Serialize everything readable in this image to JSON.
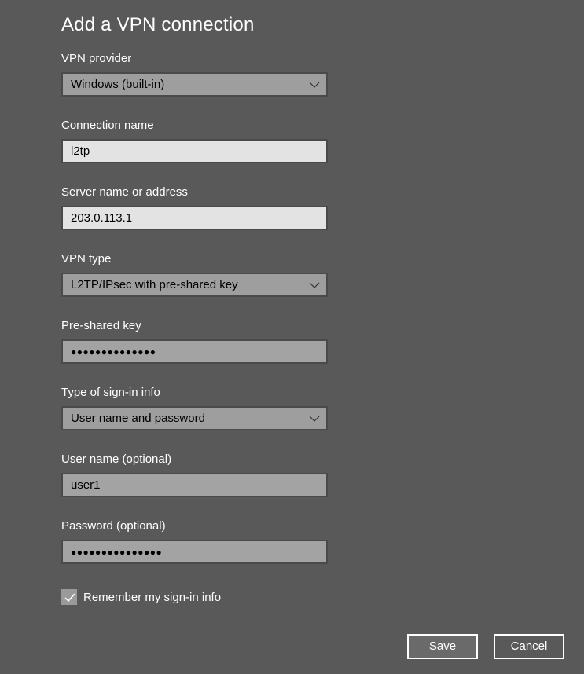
{
  "dialog": {
    "title": "Add a VPN connection"
  },
  "fields": {
    "vpn_provider": {
      "label": "VPN provider",
      "value": "Windows (built-in)"
    },
    "connection_name": {
      "label": "Connection name",
      "value": "l2tp"
    },
    "server": {
      "label": "Server name or address",
      "value": "203.0.113.1"
    },
    "vpn_type": {
      "label": "VPN type",
      "value": "L2TP/IPsec with pre-shared key"
    },
    "pre_shared_key": {
      "label": "Pre-shared key",
      "value": "●●●●●●●●●●●●●●"
    },
    "sign_in_type": {
      "label": "Type of sign-in info",
      "value": "User name and password"
    },
    "user_name": {
      "label": "User name (optional)",
      "value": "user1"
    },
    "password": {
      "label": "Password (optional)",
      "value": "●●●●●●●●●●●●●●●"
    }
  },
  "remember": {
    "label": "Remember my sign-in info",
    "checked": true
  },
  "buttons": {
    "save": "Save",
    "cancel": "Cancel"
  },
  "icons": {
    "chevron": "chevron-down-icon",
    "check": "checkmark-icon"
  }
}
